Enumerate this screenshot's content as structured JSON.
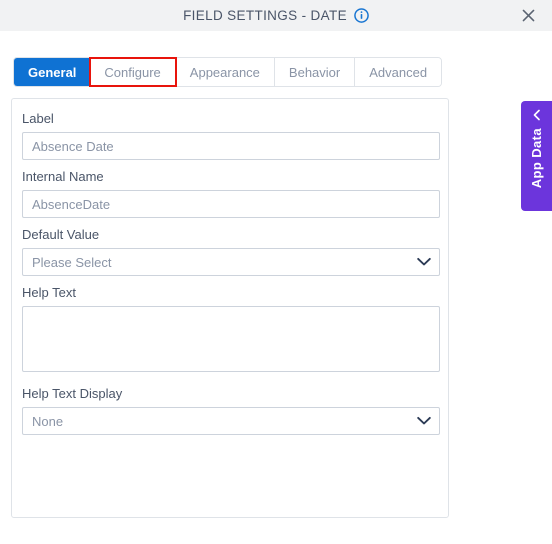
{
  "header": {
    "title": "FIELD SETTINGS - DATE",
    "info_icon": "info-circle-icon",
    "close_icon": "close-icon"
  },
  "tabs": [
    {
      "label": "General",
      "active": true,
      "highlighted": false
    },
    {
      "label": "Configure",
      "active": false,
      "highlighted": true
    },
    {
      "label": "Appearance",
      "active": false,
      "highlighted": false
    },
    {
      "label": "Behavior",
      "active": false,
      "highlighted": false
    },
    {
      "label": "Advanced",
      "active": false,
      "highlighted": false
    }
  ],
  "form": {
    "label_field": {
      "label": "Label",
      "value": "Absence Date"
    },
    "internal_name_field": {
      "label": "Internal Name",
      "value": "AbsenceDate"
    },
    "default_value_field": {
      "label": "Default Value",
      "value": "Please Select",
      "chevron_icon": "chevron-down-icon"
    },
    "help_text_field": {
      "label": "Help Text",
      "value": ""
    },
    "help_text_display_field": {
      "label": "Help Text Display",
      "value": "None",
      "chevron_icon": "chevron-down-icon"
    }
  },
  "side_panel": {
    "label": "App Data",
    "collapse_icon": "chevron-left-icon",
    "color": "#6c35dc"
  },
  "colors": {
    "active_tab": "#0f72d3",
    "highlight": "#e8140c",
    "header_bg": "#f1f2f3",
    "label_text": "#4a5568",
    "value_text": "#8a94a6",
    "border": "#cdd3dc"
  }
}
